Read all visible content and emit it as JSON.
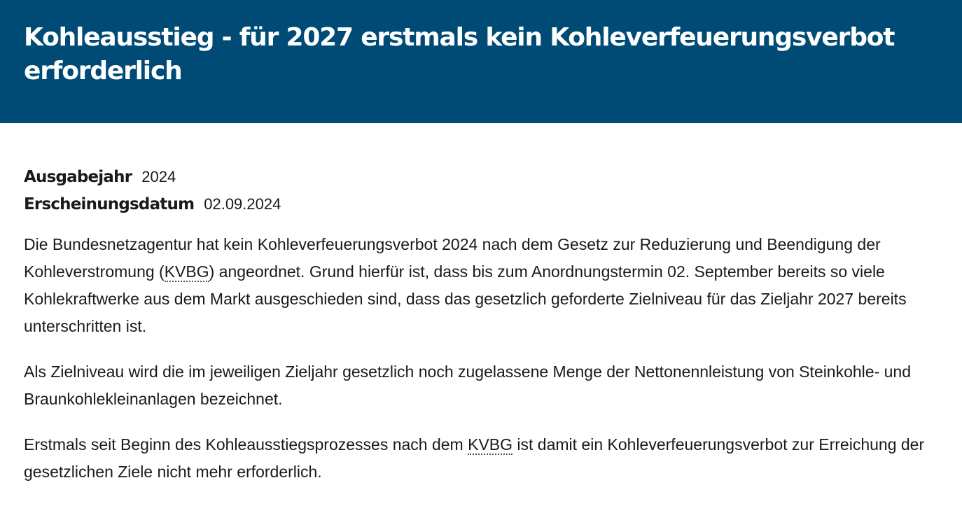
{
  "page": {
    "title": "Kohleausstieg - für 2027 erstmals kein Kohleverfeuerungsverbot erforderlich"
  },
  "meta": {
    "year_label": "Ausgabejahr",
    "year_value": "2024",
    "date_label": "Erscheinungsdatum",
    "date_value": "02.09.2024"
  },
  "body": {
    "p1_part1": "Die Bundesnetzagentur hat kein Kohleverfeuerungsverbot 2024 nach dem Gesetz zur Reduzierung und Beendigung der Kohleverstromung (",
    "p1_abbr": "KVBG",
    "p1_part2": ") angeordnet. Grund hierfür ist, dass bis zum Anordnungstermin 02. September bereits so viele Kohlekraftwerke aus dem Markt ausgeschieden sind, dass das gesetzlich geforderte Zielniveau für das Zieljahr 2027 bereits unterschritten ist.",
    "p2": "Als Zielniveau wird die im jeweiligen Zieljahr gesetzlich noch zugelassene Menge der Nettonennleistung von Steinkohle- und Braunkohlekleinanlagen bezeichnet.",
    "p3_part1": "Erstmals seit Beginn des Kohleausstiegsprozesses nach dem ",
    "p3_abbr": "KVBG",
    "p3_part2": " ist damit ein Kohleverfeuerungsverbot zur Erreichung der gesetzlichen Ziele nicht mehr erforderlich."
  }
}
